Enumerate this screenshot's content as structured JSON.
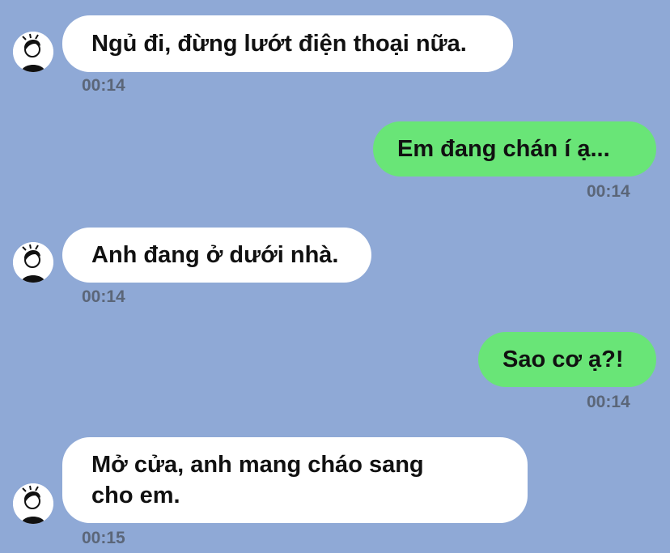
{
  "chat": {
    "background": "#8fa9d6",
    "incoming_bubble_color": "#ffffff",
    "outgoing_bubble_color": "#69e577",
    "avatar_icon": "person-avatar-icon",
    "messages": [
      {
        "direction": "incoming",
        "lines": [
          "Ngủ đi, đừng lướt điện thoại nữa."
        ],
        "time": "00:14"
      },
      {
        "direction": "outgoing",
        "lines": [
          "Em đang chán í ạ..."
        ],
        "time": "00:14"
      },
      {
        "direction": "incoming",
        "lines": [
          "Anh đang ở dưới nhà."
        ],
        "time": "00:14"
      },
      {
        "direction": "outgoing",
        "lines": [
          "Sao cơ ạ?!"
        ],
        "time": "00:14"
      },
      {
        "direction": "incoming",
        "lines": [
          "Mở cửa, anh mang cháo sang",
          "cho em."
        ],
        "time": "00:15"
      }
    ]
  }
}
